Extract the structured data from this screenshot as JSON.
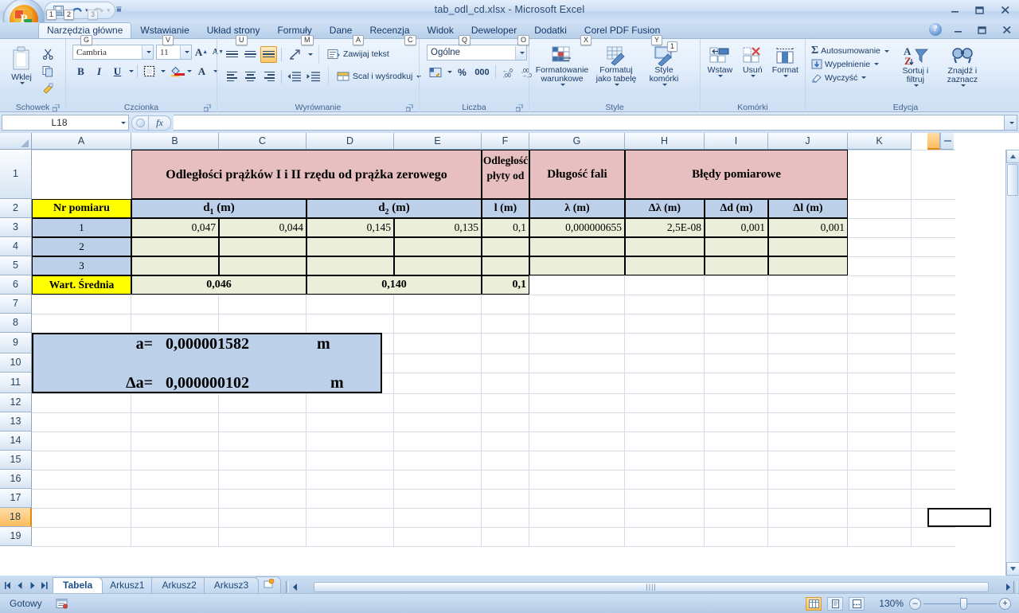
{
  "window": {
    "title": "tab_odl_cd.xlsx - Microsoft Excel",
    "minimize": "–",
    "restore": "❐",
    "close": "✕"
  },
  "quick_access": {
    "save_tip": "1",
    "undo_tip": "2",
    "redo_tip": "3",
    "customize_tip": ""
  },
  "ribbon": {
    "tabs": [
      {
        "label": "Narzędzia główne",
        "keytip": "G",
        "active": true
      },
      {
        "label": "Wstawianie",
        "keytip": "V",
        "active": false
      },
      {
        "label": "Układ strony",
        "keytip": "U",
        "active": false
      },
      {
        "label": "Formuły",
        "keytip": "M",
        "active": false
      },
      {
        "label": "Dane",
        "keytip": "A",
        "active": false
      },
      {
        "label": "Recenzja",
        "keytip": "C",
        "active": false
      },
      {
        "label": "Widok",
        "keytip": "Q",
        "active": false
      },
      {
        "label": "Deweloper",
        "keytip": "O",
        "active": false
      },
      {
        "label": "Dodatki",
        "keytip": "X",
        "active": false
      },
      {
        "label": "Corel PDF Fusion",
        "keytip": "Y",
        "active": false
      }
    ],
    "groups": {
      "clipboard": {
        "label": "Schowek",
        "paste": "Wklej",
        "cut": "cut-icon",
        "copy": "copy-icon",
        "format_painter": "format-painter-icon"
      },
      "font": {
        "label": "Czcionka",
        "font_name": "Cambria",
        "font_size": "11",
        "grow": "A",
        "shrink": "A",
        "bold": "B",
        "italic": "I",
        "underline": "U",
        "borders": "borders-icon",
        "fill_color": "fill-color-icon",
        "font_color": "A"
      },
      "alignment": {
        "label": "Wyrównanie",
        "wrap_text": "Zawijaj tekst",
        "merge_center": "Scal i wyśrodkuj"
      },
      "number": {
        "label": "Liczba",
        "format": "Ogólne",
        "percent": "%",
        "comma": "000"
      },
      "styles": {
        "label": "Style",
        "conditional": "Formatowanie warunkowe",
        "as_table": "Formatuj jako tabelę",
        "cell_styles": "Style komórki"
      },
      "cells": {
        "label": "Komórki",
        "insert": "Wstaw",
        "delete": "Usuń",
        "format": "Format"
      },
      "editing": {
        "label": "Edycja",
        "autosum": "Autosumowanie",
        "fill": "Wypełnienie",
        "clear": "Wyczyść",
        "sort_filter": "Sortuj i filtruj",
        "find_select": "Znajdź i zaznacz"
      }
    }
  },
  "formula_bar": {
    "name_box": "L18",
    "formula": "",
    "fx": "fx"
  },
  "sheet": {
    "columns": [
      "A",
      "B",
      "C",
      "D",
      "E",
      "F",
      "G",
      "H",
      "I",
      "J",
      "K"
    ],
    "selected_column": "L",
    "rows": [
      "1",
      "2",
      "3",
      "4",
      "5",
      "6",
      "7",
      "8",
      "9",
      "10",
      "11",
      "12",
      "13",
      "14",
      "15",
      "16",
      "17",
      "18",
      "19"
    ],
    "selected_row": "18",
    "headers": {
      "group_distances": "Odległości prążków I i II rzędu od prążka zerowego",
      "group_plate": "Odległość płyty od",
      "group_wavelength": "Długość fali",
      "group_errors": "Błędy pomiarowe",
      "col_nr": "Nr pomiaru",
      "col_d1": "d₁ (m)",
      "col_d2": "d₂ (m)",
      "col_l": "l (m)",
      "col_lambda": "λ (m)",
      "col_dlambda": "Δλ (m)",
      "col_dd": "Δd (m)",
      "col_dl": "Δl (m)"
    },
    "data_rows": [
      {
        "nr": "1",
        "b": "0,047",
        "c": "0,044",
        "d": "0,145",
        "e": "0,135",
        "f": "0,1",
        "g": "0,000000655",
        "h": "2,5E-08",
        "i": "0,001",
        "j": "0,001"
      },
      {
        "nr": "2",
        "b": "",
        "c": "",
        "d": "",
        "e": "",
        "f": "",
        "g": "",
        "h": "",
        "i": "",
        "j": ""
      },
      {
        "nr": "3",
        "b": "",
        "c": "",
        "d": "",
        "e": "",
        "f": "",
        "g": "",
        "h": "",
        "i": "",
        "j": ""
      }
    ],
    "average_row": {
      "label": "Wart. Średnia",
      "d1": "0,046",
      "d2": "0,140",
      "l": "0,1"
    },
    "result_box": {
      "a_label": "a=",
      "a_value": "0,000001582",
      "a_unit": "m",
      "da_label": "Δa=",
      "da_value": "0,000000102",
      "da_unit": "m"
    }
  },
  "sheet_tabs": {
    "tabs": [
      {
        "label": "Tabela",
        "active": true
      },
      {
        "label": "Arkusz1",
        "active": false
      },
      {
        "label": "Arkusz2",
        "active": false
      },
      {
        "label": "Arkusz3",
        "active": false
      }
    ],
    "new_sheet": "insert-worksheet-icon"
  },
  "status_bar": {
    "status": "Gotowy",
    "macro_icon": "record-macro-icon",
    "view_normal": "normal-view-icon",
    "view_layout": "page-layout-view-icon",
    "view_break": "page-break-view-icon",
    "zoom": "130%",
    "zoom_out": "–",
    "zoom_in": "+"
  },
  "colors": {
    "header_pink": "#e8bfc0",
    "header_blue": "#bdd0ea",
    "header_yellow": "#ffff00",
    "data_fill": "#ebeed9",
    "selection_orange": "#fcbd5c"
  }
}
